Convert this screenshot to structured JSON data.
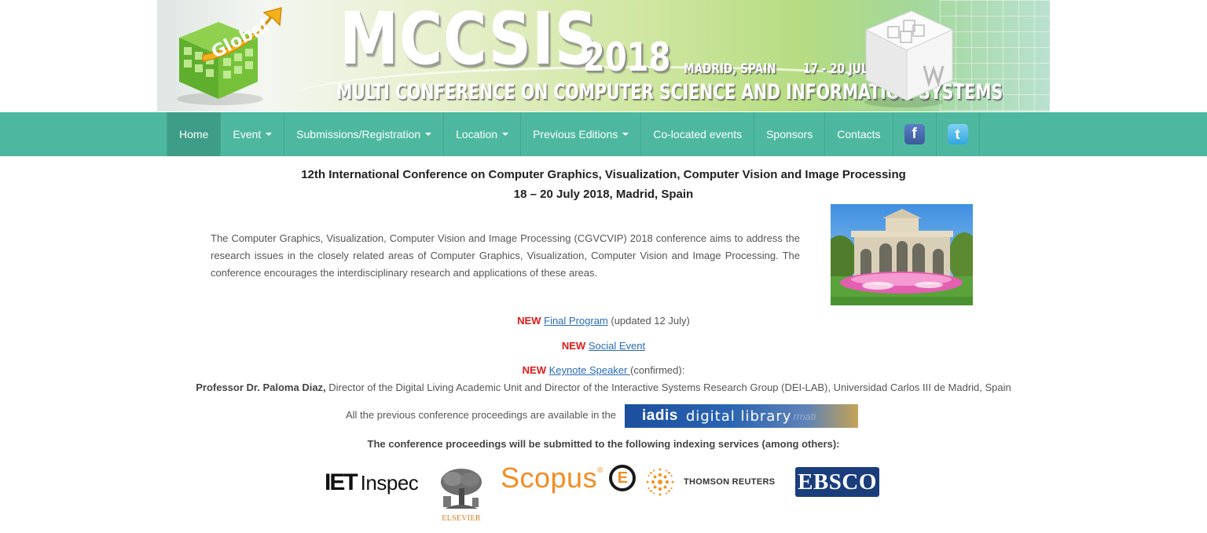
{
  "banner": {
    "title": "MCCSIS",
    "year": "2018",
    "location": "MADRID, SPAIN",
    "dates": "17 - 20 JULY",
    "subtitle": "MULTI CONFERENCE ON COMPUTER SCIENCE AND INFORMATION SYSTEMS",
    "cube_text": "Global"
  },
  "nav": {
    "items": [
      {
        "label": "Home",
        "active": true,
        "dropdown": false
      },
      {
        "label": "Event",
        "active": false,
        "dropdown": true
      },
      {
        "label": "Submissions/Registration",
        "active": false,
        "dropdown": true
      },
      {
        "label": "Location",
        "active": false,
        "dropdown": true
      },
      {
        "label": "Previous Editions",
        "active": false,
        "dropdown": true
      },
      {
        "label": "Co-located events",
        "active": false,
        "dropdown": false
      },
      {
        "label": "Sponsors",
        "active": false,
        "dropdown": false
      },
      {
        "label": "Contacts",
        "active": false,
        "dropdown": false
      }
    ],
    "facebook_glyph": "f",
    "twitter_glyph": "t",
    "colors": {
      "bar": "#4db89f",
      "active": "#3e9d86"
    }
  },
  "content": {
    "title": "12th International Conference on Computer Graphics, Visualization, Computer Vision and Image Processing",
    "dates": "18 – 20 July 2018, Madrid, Spain",
    "intro": "The Computer Graphics, Visualization, Computer Vision and Image Processing (CGVCVIP) 2018 conference aims to address the research issues in the closely related areas of Computer Graphics, Visualization, Computer Vision and Image Processing. The conference encourages the interdisciplinary research and applications of these areas.",
    "news": [
      {
        "tag": "NEW",
        "link": "Final Program",
        "suffix": " (updated 12 July)"
      },
      {
        "tag": "NEW",
        "link": "Social Event",
        "suffix": ""
      },
      {
        "tag": "NEW",
        "link": "Keynote Speaker ",
        "suffix": "(confirmed):"
      }
    ],
    "keynote_name": "Professor Dr. Paloma Diaz,",
    "keynote_desc": " Director of the Digital Living Academic Unit and Director of the Interactive Systems Research Group (DEI-LAB), Universidad Carlos III de Madrid, Spain",
    "proceedings_text": "All the previous conference proceedings are available in the",
    "iadis_word": "iadis",
    "iadis_dl": "digital library",
    "iadis_ghost": "rmati",
    "indexing_text": "The conference proceedings will be submitted to the following indexing services (among others):"
  },
  "logos": {
    "iet": "IET",
    "inspec": "Inspec",
    "elsevier": "ELSEVIER",
    "scopus": "Scopus",
    "scopus_reg": "®",
    "scopus_e": "E",
    "thomson": "THOMSON REUTERS",
    "ebsco": "EBSCO"
  }
}
